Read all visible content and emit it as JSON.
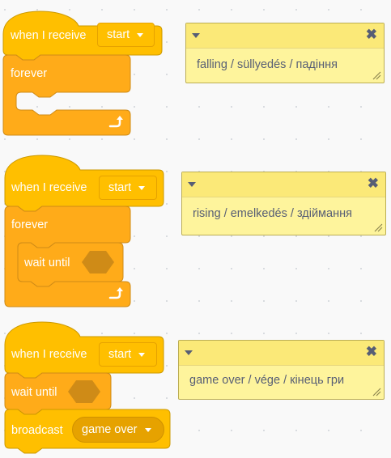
{
  "scripts": [
    {
      "hat": {
        "label": "when I receive",
        "menu": "start"
      },
      "loop": {
        "label": "forever"
      },
      "comment": {
        "text": "falling / süllyedés / падіння"
      }
    },
    {
      "hat": {
        "label": "when I receive",
        "menu": "start"
      },
      "loop": {
        "label": "forever"
      },
      "inner": {
        "label": "wait until"
      },
      "comment": {
        "text": "rising / emelkedés / здіймання"
      }
    },
    {
      "hat": {
        "label": "when I receive",
        "menu": "start"
      },
      "wait": {
        "label": "wait until"
      },
      "broadcast": {
        "label": "broadcast",
        "menu": "game over"
      },
      "comment": {
        "text": "game over / vége / кінець гри"
      }
    }
  ],
  "icons": {
    "loop_arrow": "repeat-arrow-icon",
    "collapse": "chevron-down-icon",
    "close": "close-icon",
    "resize": "resize-handle-icon"
  },
  "colors": {
    "events": "#ffbf00",
    "control": "#ffab19",
    "comment": "#fef49c",
    "comment_header": "#fbe978",
    "boolean_slot": "#cf8b17"
  }
}
